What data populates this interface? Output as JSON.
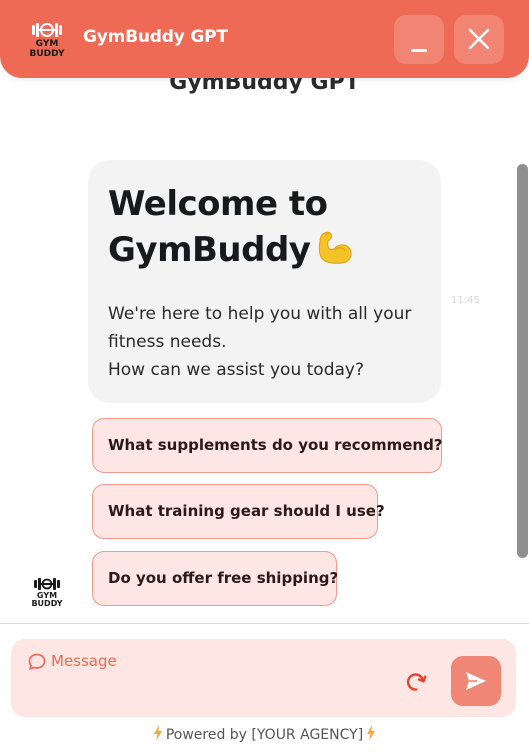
{
  "header": {
    "title": "GymBuddy GPT",
    "logo_text_line1": "GYM",
    "logo_text_line2": "BUDDY",
    "minimize_icon": "minimize-icon",
    "close_icon": "close-icon",
    "bg_color": "#ee6a55"
  },
  "chat": {
    "title": "GymBuddy GPT",
    "welcome": {
      "heading": "Welcome to GymBuddy",
      "emoji_icon": "flexed-biceps-icon",
      "line1": "We're here to help you with all your fitness needs.",
      "line2": "How can we assist you today?",
      "time": "11:45"
    },
    "suggestions": [
      "What supplements do you recommend?",
      "What training gear should I use?",
      "Do you offer free shipping?"
    ]
  },
  "composer": {
    "placeholder": "Message",
    "message_icon": "chat-bubble-icon",
    "refresh_icon": "refresh-icon",
    "send_icon": "send-icon"
  },
  "footer": {
    "powered_by": "Powered by [YOUR AGENCY]",
    "bolt_icon": "lightning-bolt-icon"
  },
  "colors": {
    "accent": "#ee6a55",
    "suggestion_bg": "#fde6e3",
    "suggestion_border": "#f19a8e",
    "send_button": "#f08676"
  }
}
